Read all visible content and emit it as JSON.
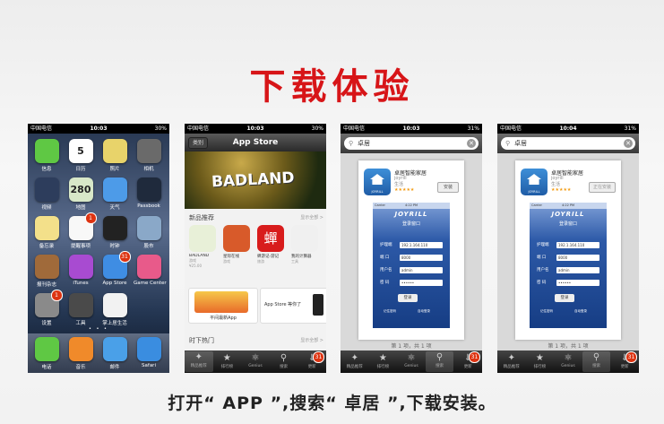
{
  "heading": "下载体验",
  "caption": "打开“ APP ”,搜索“ 卓居 ”,下载安装。",
  "status": {
    "carrier": "中国电信",
    "time1": "10:03",
    "time4": "10:04",
    "battery1": "30%",
    "battery3": "31%"
  },
  "home": {
    "icons": [
      {
        "label": "信息",
        "icon": "messages-icon",
        "color": "#5fc844"
      },
      {
        "label": "日历",
        "icon": "calendar-icon",
        "color": "#ffffff",
        "text": "5"
      },
      {
        "label": "照片",
        "icon": "photos-icon",
        "color": "#e8d36a"
      },
      {
        "label": "相机",
        "icon": "camera-icon",
        "color": "#6a6a6a"
      },
      {
        "label": "视频",
        "icon": "videos-icon",
        "color": "#2d3d5c"
      },
      {
        "label": "地图",
        "icon": "maps-icon",
        "color": "#d8e8c8",
        "text": "280"
      },
      {
        "label": "天气",
        "icon": "weather-icon",
        "color": "#4d9be8"
      },
      {
        "label": "Passbook",
        "icon": "passbook-icon",
        "color": "#1f2a3c"
      },
      {
        "label": "备忘录",
        "icon": "notes-icon",
        "color": "#f3e08a"
      },
      {
        "label": "提醒事项",
        "icon": "reminders-icon",
        "color": "#f8f8f8",
        "badge": "1"
      },
      {
        "label": "时钟",
        "icon": "clock-icon",
        "color": "#222222"
      },
      {
        "label": "股市",
        "icon": "stocks-icon",
        "color": "#8aa8c8"
      },
      {
        "label": "报刊杂志",
        "icon": "newsstand-icon",
        "color": "#a06a3a"
      },
      {
        "label": "iTunes",
        "icon": "itunes-icon",
        "color": "#a84bd1"
      },
      {
        "label": "App Store",
        "icon": "appstore-icon",
        "color": "#3f8de3",
        "badge": "31"
      },
      {
        "label": "Game Center",
        "icon": "gamecenter-icon",
        "color": "#e85a8a"
      },
      {
        "label": "设置",
        "icon": "settings-icon",
        "color": "#8a8a8a",
        "badge": "1"
      },
      {
        "label": "工具",
        "icon": "tools-folder-icon",
        "color": "#4a4a4a"
      },
      {
        "label": "掌上居生活",
        "icon": "home-app-icon",
        "color": "#f2f2f2"
      }
    ],
    "dock": [
      {
        "label": "电话",
        "icon": "phone-icon",
        "color": "#5fc844"
      },
      {
        "label": "音乐",
        "icon": "music-icon",
        "color": "#f08a2a"
      },
      {
        "label": "邮件",
        "icon": "mail-icon",
        "color": "#4aa0e8"
      },
      {
        "label": "Safari",
        "icon": "safari-icon",
        "color": "#3a8de0"
      }
    ],
    "page_dots": "• • •"
  },
  "appstore": {
    "title": "App Store",
    "back_label": "类别",
    "banner_text": "BADLAND",
    "section1": "新品推荐",
    "section1_more": "显示全部 >",
    "apps": [
      {
        "label": "BADLAND",
        "sub": "游戏",
        "sub2": "¥25.00",
        "color": "#e8f0d8"
      },
      {
        "label": "星际在线",
        "sub": "游戏",
        "color": "#d85a2a"
      },
      {
        "label": "蝉游记-游记",
        "sub": "旅游",
        "color": "#d81c1c",
        "text": "蟬"
      },
      {
        "label": "我的计算器",
        "sub": "工具",
        "color": "#f0f0f0"
      }
    ],
    "promo1": "平间最新App",
    "promo2": "App Store 等你了",
    "section2": "时下热门",
    "section2_more": "显示全部 >",
    "tabs": [
      {
        "label": "精品推荐",
        "icon": "featured-icon"
      },
      {
        "label": "排行榜",
        "icon": "star-icon"
      },
      {
        "label": "Genius",
        "icon": "genius-icon"
      },
      {
        "label": "搜索",
        "icon": "search-icon"
      },
      {
        "label": "更新",
        "icon": "updates-icon",
        "badge": "31"
      }
    ]
  },
  "search": {
    "query": "卓居",
    "app_name": "卓居智能家居",
    "developer": "joyrill",
    "category": "生活",
    "stars": "★★★★★",
    "install_label": "安装",
    "installed_label": "正在安装",
    "results": "第 1 项，共 1 项",
    "screenshot": {
      "carrier": "Carrier",
      "time": "4:22 PM",
      "brand": "JOYRILL",
      "login_title": "登录窗口",
      "fields": [
        {
          "label": "护理端",
          "value": "192.1.164.110"
        },
        {
          "label": "端 口",
          "value": "8000"
        },
        {
          "label": "用户名",
          "value": "admin"
        },
        {
          "label": "密 码",
          "value": "••••••"
        }
      ],
      "login_button": "登录",
      "opt1": "记住密码",
      "opt2": "自动登录"
    }
  }
}
